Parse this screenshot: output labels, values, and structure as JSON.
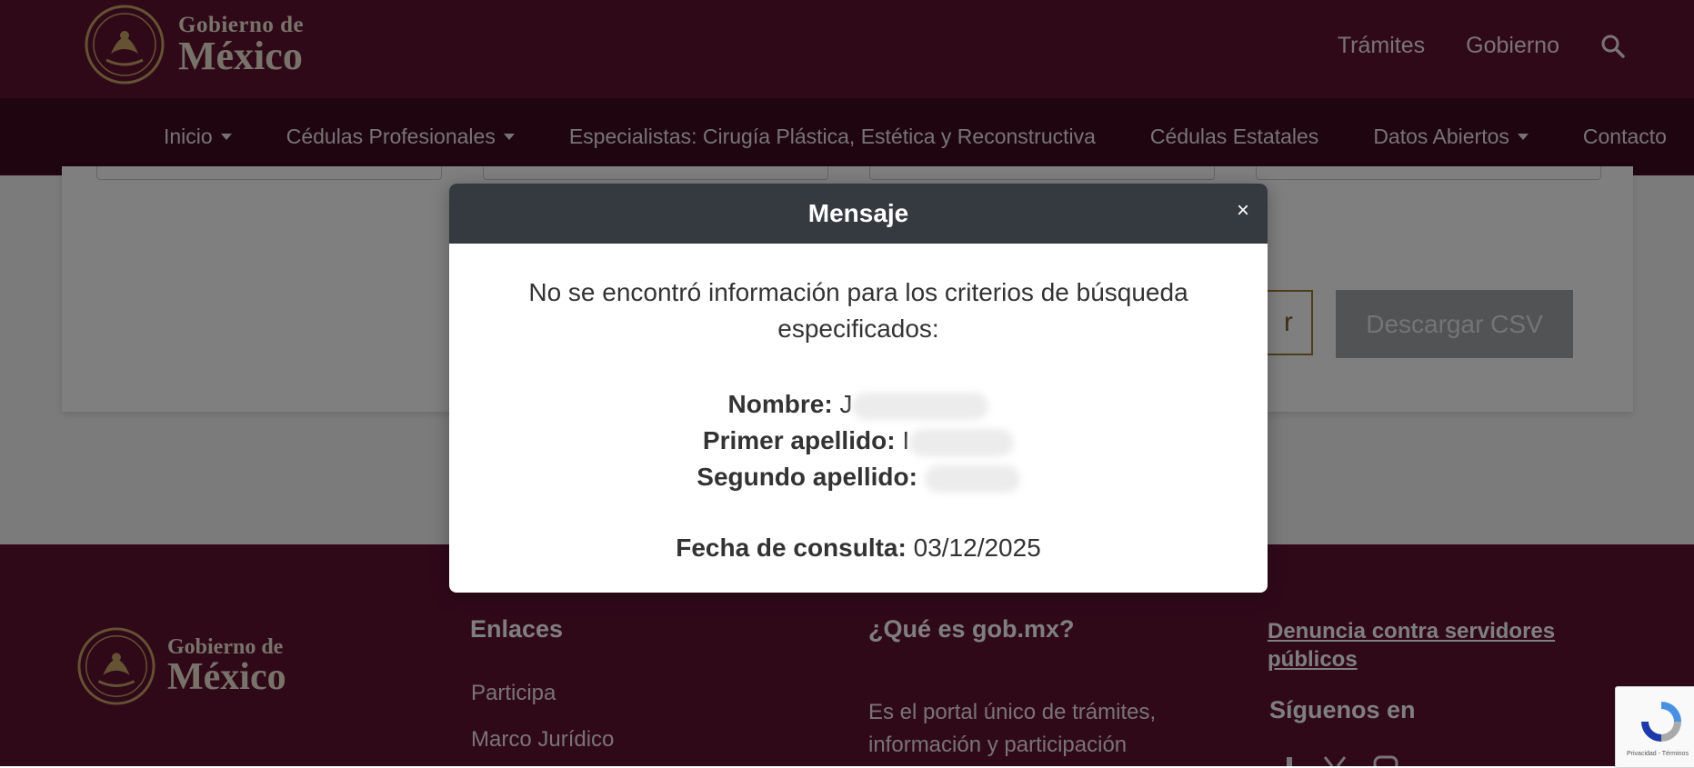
{
  "header": {
    "brand_line1": "Gobierno de",
    "brand_line2": "México",
    "links": [
      "Trámites",
      "Gobierno"
    ]
  },
  "nav": {
    "items": [
      {
        "label": "Inicio",
        "dropdown": true
      },
      {
        "label": "Cédulas Profesionales",
        "dropdown": true
      },
      {
        "label": "Especialistas: Cirugía Plástica, Estética y Reconstructiva",
        "dropdown": false
      },
      {
        "label": "Cédulas Estatales",
        "dropdown": false
      },
      {
        "label": "Datos Abiertos",
        "dropdown": true
      },
      {
        "label": "Contacto",
        "dropdown": false
      }
    ]
  },
  "page": {
    "outline_button_label": "r",
    "csv_button_label": "Descargar CSV"
  },
  "modal": {
    "title": "Mensaje",
    "close": "×",
    "message": "No se encontró información para los criterios de búsqueda especificados:",
    "criteria": [
      {
        "label": "Nombre:",
        "value_prefix": "J"
      },
      {
        "label": "Primer apellido:",
        "value_prefix": "I"
      },
      {
        "label": "Segundo apellido:",
        "value_prefix": ""
      }
    ],
    "fecha_label": "Fecha de consulta:",
    "fecha_value": "03/12/2025"
  },
  "footer": {
    "brand_line1": "Gobierno de",
    "brand_line2": "México",
    "enlaces_title": "Enlaces",
    "enlaces": [
      "Participa",
      "Marco Jurídico"
    ],
    "que_es_title": "¿Qué es gob.mx?",
    "que_es_text": "Es el portal único de trámites, información y participación",
    "denuncia": "Denuncia contra servidores públicos",
    "siguenos": "Síguenos en"
  },
  "recaptcha": {
    "text": "Privacidad - Términos"
  },
  "colors": {
    "header": "#611232",
    "nav": "#3e0a1f",
    "modal_header": "#343a40",
    "accent_gold": "#9d7a36"
  }
}
